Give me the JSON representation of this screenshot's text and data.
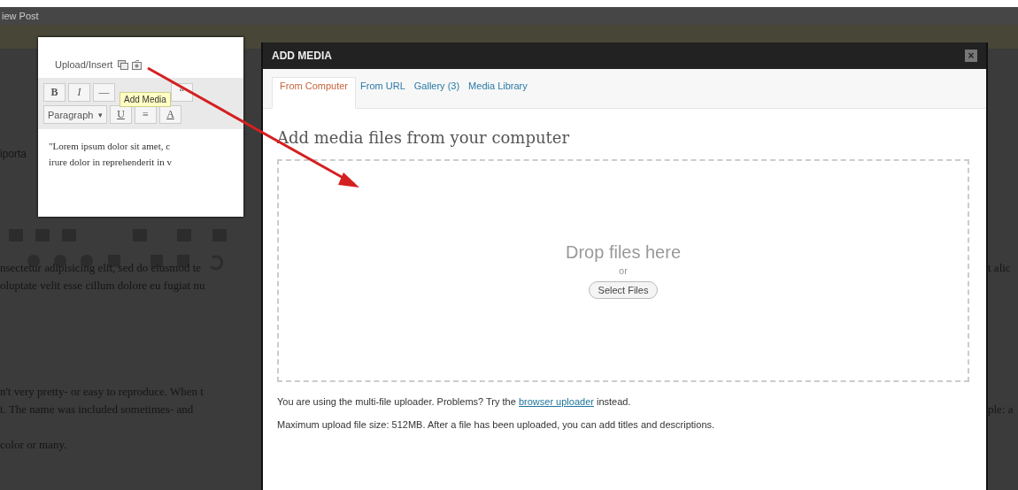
{
  "admin_bar": {
    "title": "iew Post"
  },
  "editor": {
    "side_label": "iporta",
    "paragraphs": [
      {
        "lines": [
          "nsectetur adipisicing elit, sed do eiusmod te",
          "oluptate velit esse cillum dolore eu fugiat nu"
        ]
      },
      {
        "lines": [
          "n't very pretty- or easy to reproduce. When t",
          "t. The name was included sometimes- and"
        ]
      },
      {
        "lines": [
          "color or many."
        ]
      }
    ],
    "right_fragments": [
      "t alic",
      "ple: a"
    ]
  },
  "callout": {
    "label": "Upload/Insert",
    "row_1": [
      {
        "label": "B",
        "kind": "bold"
      },
      {
        "label": "I",
        "kind": "italic"
      },
      {
        "label": "—",
        "kind": "plain"
      },
      {
        "label": "“",
        "kind": "plain"
      }
    ],
    "format_select": "Paragraph",
    "caret": "▾",
    "row_2": [
      {
        "label": "U",
        "kind": "underline"
      },
      {
        "label": "≡",
        "kind": "plain"
      },
      {
        "label": "A",
        "kind": "underline"
      }
    ],
    "tooltip": "Add Media",
    "text_lines": [
      "\"Lorem ipsum dolor sit amet, c",
      "irure dolor in reprehenderit in v"
    ]
  },
  "modal": {
    "title": "ADD MEDIA",
    "close": "×",
    "tabs": [
      {
        "label": "From Computer",
        "selected": true
      },
      {
        "label": "From URL",
        "selected": false
      },
      {
        "label": "Gallery (3)",
        "selected": false
      },
      {
        "label": "Media Library",
        "selected": false
      }
    ],
    "heading": "Add media files from your computer",
    "drop_zone": {
      "title": "Drop files here",
      "or": "or",
      "button": "Select Files"
    },
    "note": {
      "before": "You are using the multi-file uploader. Problems? Try the ",
      "link": "browser uploader",
      "after": " instead."
    },
    "limits": "Maximum upload file size: 512MB. After a file has been uploaded, you can add titles and descriptions."
  }
}
